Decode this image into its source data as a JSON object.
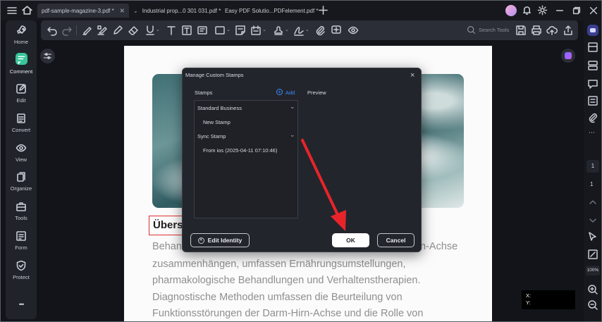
{
  "tabs": [
    {
      "label": "pdf-sample-magazine-3.pdf *",
      "active": true
    },
    {
      "label": "Industrial  prop...0 301 031.pdf *",
      "active": false
    },
    {
      "label": "Easy PDF Solutio...PDFelement.pdf *",
      "active": false
    }
  ],
  "toolbar": {
    "search_placeholder": "Search Tools"
  },
  "leftnav": {
    "items": [
      {
        "label": "Home",
        "icon": "rocket-icon"
      },
      {
        "label": "Comment",
        "icon": "comment-icon"
      },
      {
        "label": "Edit",
        "icon": "edit-icon"
      },
      {
        "label": "Convert",
        "icon": "convert-icon"
      },
      {
        "label": "View",
        "icon": "eye-icon"
      },
      {
        "label": "Organize",
        "icon": "organize-icon"
      },
      {
        "label": "Tools",
        "icon": "toolbox-icon"
      },
      {
        "label": "Form",
        "icon": "form-icon"
      },
      {
        "label": "Protect",
        "icon": "shield-icon"
      }
    ],
    "more": "•••"
  },
  "document": {
    "heading_partial": "Übersi",
    "lines": [
      "Behan",
      "n-Achse",
      "zusammenhängen, umfassen Ernährungsumstellungen,",
      "pharmakologische Behandlungen und Verhaltenstherapien.",
      "Diagnostische Methoden umfassen die Beurteilung von",
      "Funktionsstörungen der Darm-Hirn-Achse und die Rolle von"
    ]
  },
  "dialog": {
    "title": "Manage Custom Stamps",
    "stamps_label": "Stamps",
    "add_label": "Add",
    "preview_label": "Preview",
    "groups": [
      {
        "name": "Standard Business",
        "items": [
          "New Stamp"
        ]
      },
      {
        "name": "Sync Stamp",
        "items": [
          "From ios (2025-04-11 07:10:46)"
        ]
      }
    ],
    "edit_identity_label": "Edit Identity",
    "ok_label": "OK",
    "cancel_label": "Cancel"
  },
  "rightrail": {
    "page_current": "1",
    "page_total": "1",
    "zoom": "100%"
  },
  "coords": {
    "x_label": "X:",
    "y_label": "Y:"
  },
  "colors": {
    "accent": "#3a8dff",
    "annotation_arrow": "#e8242a",
    "ok_button": "#ffffff"
  }
}
